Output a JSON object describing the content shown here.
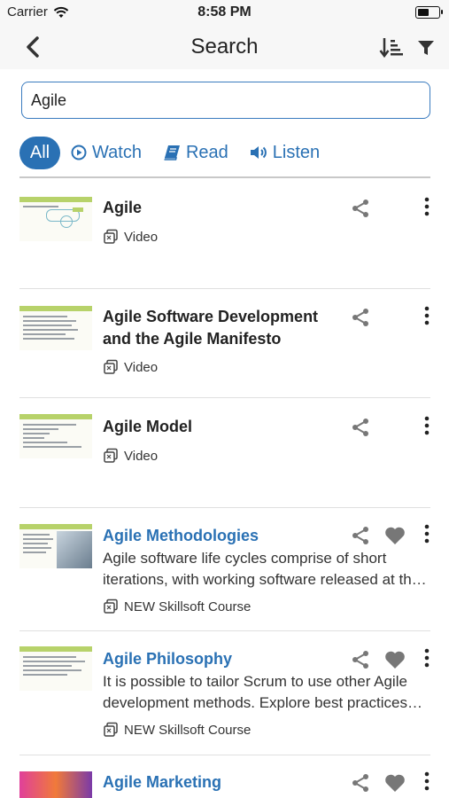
{
  "status_bar": {
    "carrier": "Carrier",
    "time": "8:58 PM",
    "battery_level": 0.55
  },
  "nav": {
    "title": "Search"
  },
  "search": {
    "value": "Agile"
  },
  "tabs": {
    "all": "All",
    "watch": "Watch",
    "read": "Read",
    "listen": "Listen"
  },
  "results": [
    {
      "title": "Agile",
      "type": "Video"
    },
    {
      "title": "Agile Software Development and the Agile Manifesto",
      "type": "Video"
    },
    {
      "title": "Agile Model",
      "type": "Video"
    },
    {
      "title": "Agile Methodologies",
      "description": "Agile software life cycles comprise of short iterations, with working software released at th…",
      "type": "NEW Skillsoft Course"
    },
    {
      "title": "Agile Philosophy",
      "description": "It is possible to tailor Scrum to use other Agile development methods. Explore best practices…",
      "type": "NEW Skillsoft Course"
    },
    {
      "title": "Agile Marketing"
    }
  ],
  "colors": {
    "accent": "#2a71b4",
    "icon_gray": "#777777",
    "thumb_green": "#b7d26a"
  }
}
